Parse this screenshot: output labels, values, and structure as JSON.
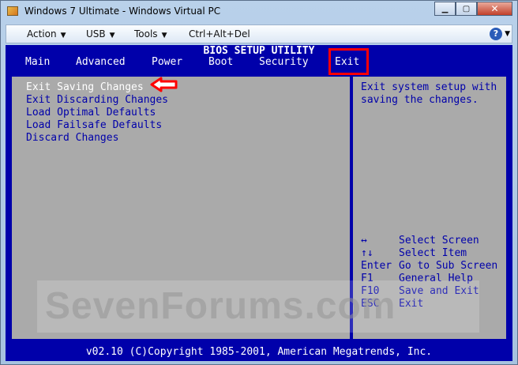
{
  "window": {
    "title": "Windows 7 Ultimate - Windows Virtual PC",
    "buttons": {
      "minimize": "▁",
      "maximize": "▢",
      "close": "✕"
    }
  },
  "menubar": {
    "items": [
      {
        "label": "Action"
      },
      {
        "label": "USB"
      },
      {
        "label": "Tools"
      },
      {
        "label": "Ctrl+Alt+Del"
      }
    ],
    "caret": "▼",
    "help": "?"
  },
  "bios": {
    "title": "BIOS SETUP UTILITY",
    "tabs": [
      "Main",
      "Advanced",
      "Power",
      "Boot",
      "Security",
      "Exit"
    ],
    "active_tab": "Exit",
    "options": [
      "Exit Saving Changes",
      "Exit Discarding Changes",
      "Load Optimal Defaults",
      "Load Failsafe Defaults",
      "Discard Changes"
    ],
    "selected_option": "Exit Saving Changes",
    "help_text": [
      "Exit system setup with",
      "saving the changes."
    ],
    "keys": [
      {
        "key": "↔",
        "desc": "Select Screen"
      },
      {
        "key": "↑↓",
        "desc": "Select Item"
      },
      {
        "key": "Enter",
        "desc": "Go to Sub Screen"
      },
      {
        "key": "F1",
        "desc": "General Help"
      },
      {
        "key": "F10",
        "desc": "Save and Exit"
      },
      {
        "key": "ESC",
        "desc": "Exit"
      }
    ],
    "footer": "v02.10 (C)Copyright 1985-2001, American Megatrends, Inc."
  },
  "watermark": "SevenForums.com",
  "colors": {
    "bios_blue": "#0000aa",
    "bios_gray": "#aaaaaa",
    "annotation_red": "#ff0000"
  }
}
